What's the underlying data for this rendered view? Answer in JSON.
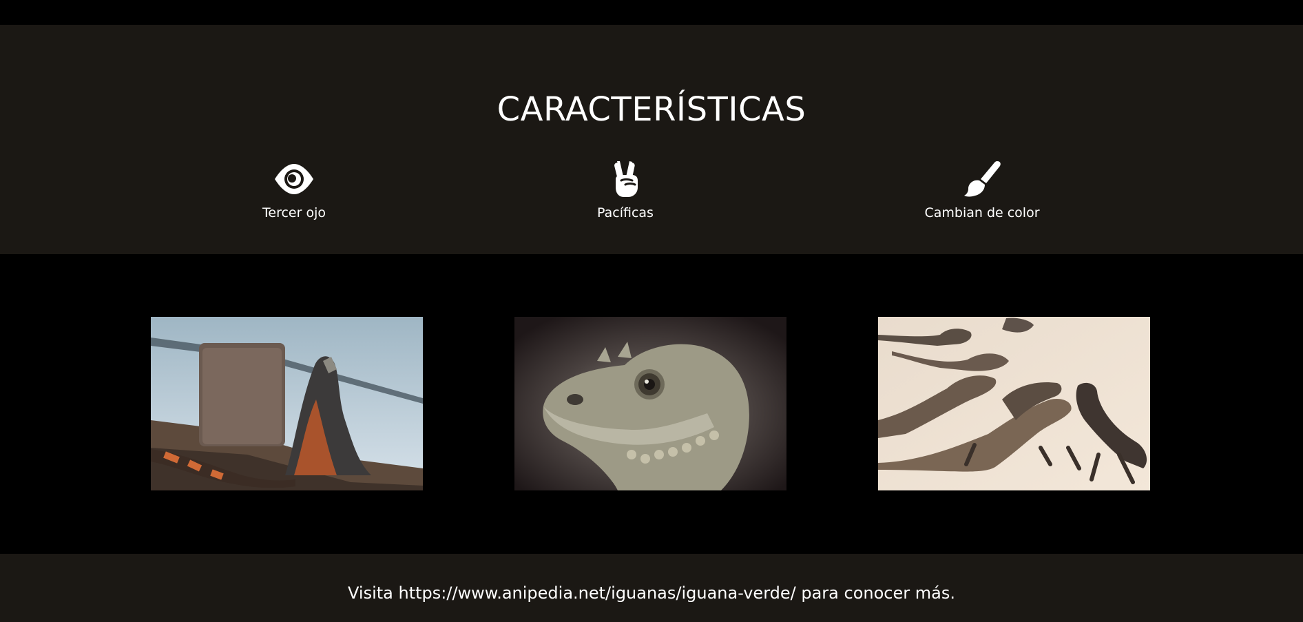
{
  "features": {
    "title": "CARACTERÍSTICAS",
    "items": [
      {
        "icon": "eye-icon",
        "label": "Tercer ojo"
      },
      {
        "icon": "peace-hand-icon",
        "label": "Pacíficas"
      },
      {
        "icon": "paintbrush-icon",
        "label": "Cambian de color"
      }
    ]
  },
  "gallery": {
    "images": [
      {
        "name": "iguana-by-water-photo"
      },
      {
        "name": "iguana-head-closeup-photo"
      },
      {
        "name": "iguanas-on-sand-photo"
      }
    ]
  },
  "footer": {
    "text": "Visita https://www.anipedia.net/iguanas/iguana-verde/ para conocer más."
  },
  "colors": {
    "section_background": "#1b1814",
    "page_background": "#000000",
    "text": "#ffffff"
  }
}
